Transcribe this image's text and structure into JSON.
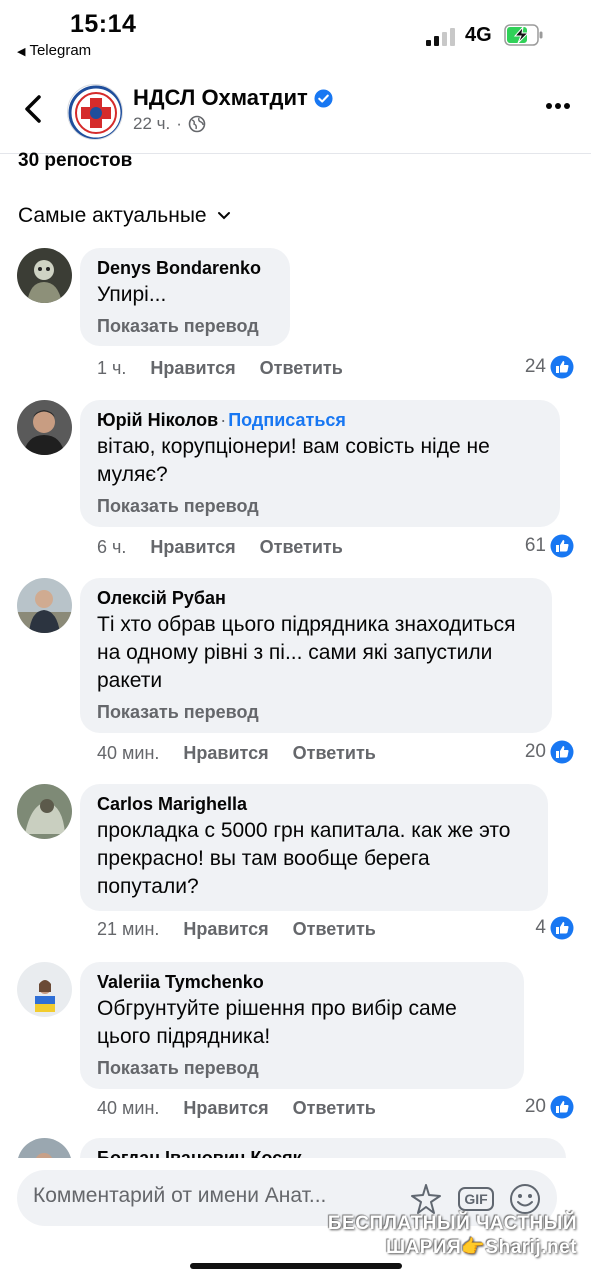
{
  "status": {
    "time": "15:14",
    "back_app": "Telegram",
    "network": "4G"
  },
  "header": {
    "page_name": "НДСЛ Охматдит",
    "post_age": "22 ч."
  },
  "reposts": "30 репостов",
  "sort_label": "Самые актуальные",
  "action_labels": {
    "like": "Нравится",
    "reply": "Ответить"
  },
  "translate_label": "Показать перевод",
  "comments": [
    {
      "author": "Denys Bondarenko",
      "text": "Упирі...",
      "age": "1 ч.",
      "likes": "24"
    },
    {
      "author": "Юрій Ніколов",
      "separator": "·",
      "follow": "Подписаться",
      "text": "вітаю, корупціонери! вам совість ніде не муляє?",
      "age": "6 ч.",
      "likes": "61"
    },
    {
      "author": "Олексій Рубан",
      "text": "Ті хто обрав цього підрядника знаходиться на одному рівні з пі... сами які запустили ракети",
      "age": "40 мин.",
      "likes": "20"
    },
    {
      "author": "Carlos  Marighella",
      "text": "прокладка с 5000 грн капитала. как же это прекрасно! вы там вообще берега попутали?",
      "age": "21 мин.",
      "likes": "4"
    },
    {
      "author": "Valeriia Tymchenko",
      "text": "Обгрунтуйте рішення про вибір саме цього підрядника!",
      "age": "40 мин.",
      "likes": "20"
    },
    {
      "author": "Богдан Іванович Косяк"
    }
  ],
  "composer": {
    "placeholder": "Комментарий от имени Анат...",
    "gif_label": "GIF"
  },
  "watermark": {
    "line1": "БЕСПЛАТНЫЙ ЧАСТНЫЙ",
    "line2": "ШАРИЯ👉Sharij.net"
  },
  "colors": {
    "accent": "#1877f2",
    "bubble": "#f0f2f5",
    "secondary_text": "#65676b",
    "battery_green": "#30d158"
  },
  "icons": [
    "chevron-left-icon",
    "verified-badge-icon",
    "globe-icon",
    "more-icon",
    "chevron-down-icon",
    "like-icon",
    "sparkle-sticker-icon",
    "gif-icon",
    "emoji-icon"
  ]
}
